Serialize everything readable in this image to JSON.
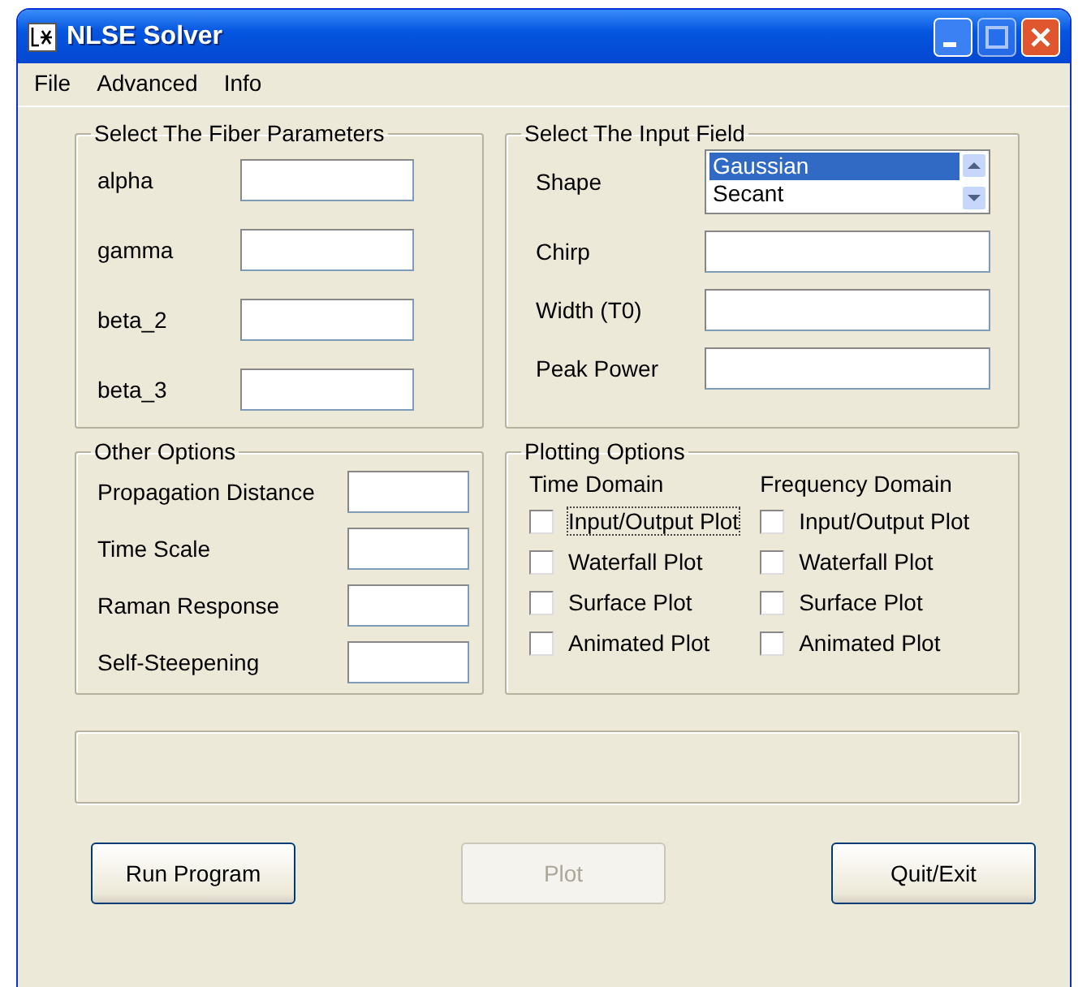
{
  "window": {
    "title": "NLSE Solver"
  },
  "menu": [
    {
      "label": "File"
    },
    {
      "label": "Advanced"
    },
    {
      "label": "Info"
    }
  ],
  "fiber_parameters": {
    "title": "Select The Fiber Parameters",
    "fields": [
      {
        "label": "alpha"
      },
      {
        "label": "gamma"
      },
      {
        "label": "beta_2"
      },
      {
        "label": "beta_3"
      }
    ]
  },
  "input_field": {
    "title": "Select The Input Field",
    "shape": {
      "label": "Shape",
      "items": [
        {
          "label": "Gaussian",
          "selected": true
        },
        {
          "label": "Secant",
          "selected": false
        }
      ]
    },
    "fields": [
      {
        "label": "Chirp"
      },
      {
        "label": "Width (T0)"
      },
      {
        "label": "Peak Power"
      }
    ]
  },
  "other_options": {
    "title": "Other Options",
    "fields": [
      {
        "label": "Propagation Distance"
      },
      {
        "label": "Time Scale"
      },
      {
        "label": "Raman Response"
      },
      {
        "label": "Self-Steepening"
      }
    ]
  },
  "plotting_options": {
    "title": "Plotting Options",
    "columns": [
      {
        "heading": "Time Domain",
        "options": [
          {
            "label": "Input/Output Plot",
            "checked": false,
            "focused": true
          },
          {
            "label": "Waterfall Plot",
            "checked": false,
            "focused": false
          },
          {
            "label": "Surface Plot",
            "checked": false,
            "focused": false
          },
          {
            "label": "Animated Plot",
            "checked": false,
            "focused": false
          }
        ]
      },
      {
        "heading": "Frequency Domain",
        "options": [
          {
            "label": "Input/Output Plot",
            "checked": false,
            "focused": false
          },
          {
            "label": "Waterfall Plot",
            "checked": false,
            "focused": false
          },
          {
            "label": "Surface Plot",
            "checked": false,
            "focused": false
          },
          {
            "label": "Animated Plot",
            "checked": false,
            "focused": false
          }
        ]
      }
    ]
  },
  "buttons": [
    {
      "label": "Run Program",
      "disabled": false
    },
    {
      "label": "Plot",
      "disabled": true
    },
    {
      "label": "Quit/Exit",
      "disabled": false
    }
  ]
}
